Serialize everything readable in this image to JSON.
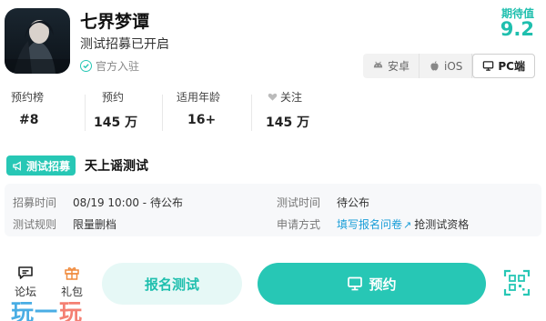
{
  "game": {
    "title": "七界梦谭",
    "subtitle": "测试招募已开启",
    "official_label": "官方入驻"
  },
  "rating": {
    "label": "期待值",
    "value": "9.2"
  },
  "platforms": [
    {
      "label": "安卓",
      "icon": "android-icon",
      "active": false
    },
    {
      "label": "iOS",
      "icon": "apple-icon",
      "active": false
    },
    {
      "label": "PC端",
      "icon": "monitor-icon",
      "active": true
    }
  ],
  "stats": [
    {
      "label": "预约榜",
      "value": "#8"
    },
    {
      "label": "预约",
      "value": "145 万"
    },
    {
      "label": "适用年龄",
      "value": "16+"
    },
    {
      "label": "关注",
      "value": "145 万",
      "icon": "heart-icon"
    }
  ],
  "recruit": {
    "badge": "测试招募",
    "title": "天上谣测试"
  },
  "info": {
    "recruit_time_label": "招募时间",
    "recruit_time_value": "08/19 10:00 - 待公布",
    "test_time_label": "测试时间",
    "test_time_value": "待公布",
    "rules_label": "测试规则",
    "rules_value": "限量删档",
    "apply_label": "申请方式",
    "apply_link": "填写报名问卷",
    "apply_extra": "抢测试资格"
  },
  "bottom": {
    "forum_label": "论坛",
    "gift_label": "礼包",
    "signup_label": "报名测试",
    "reserve_label": "预约"
  },
  "watermark": {
    "text_a": "玩一",
    "text_b": "玩"
  },
  "colors": {
    "accent": "#27c7b5",
    "link": "#1a9ed8"
  }
}
